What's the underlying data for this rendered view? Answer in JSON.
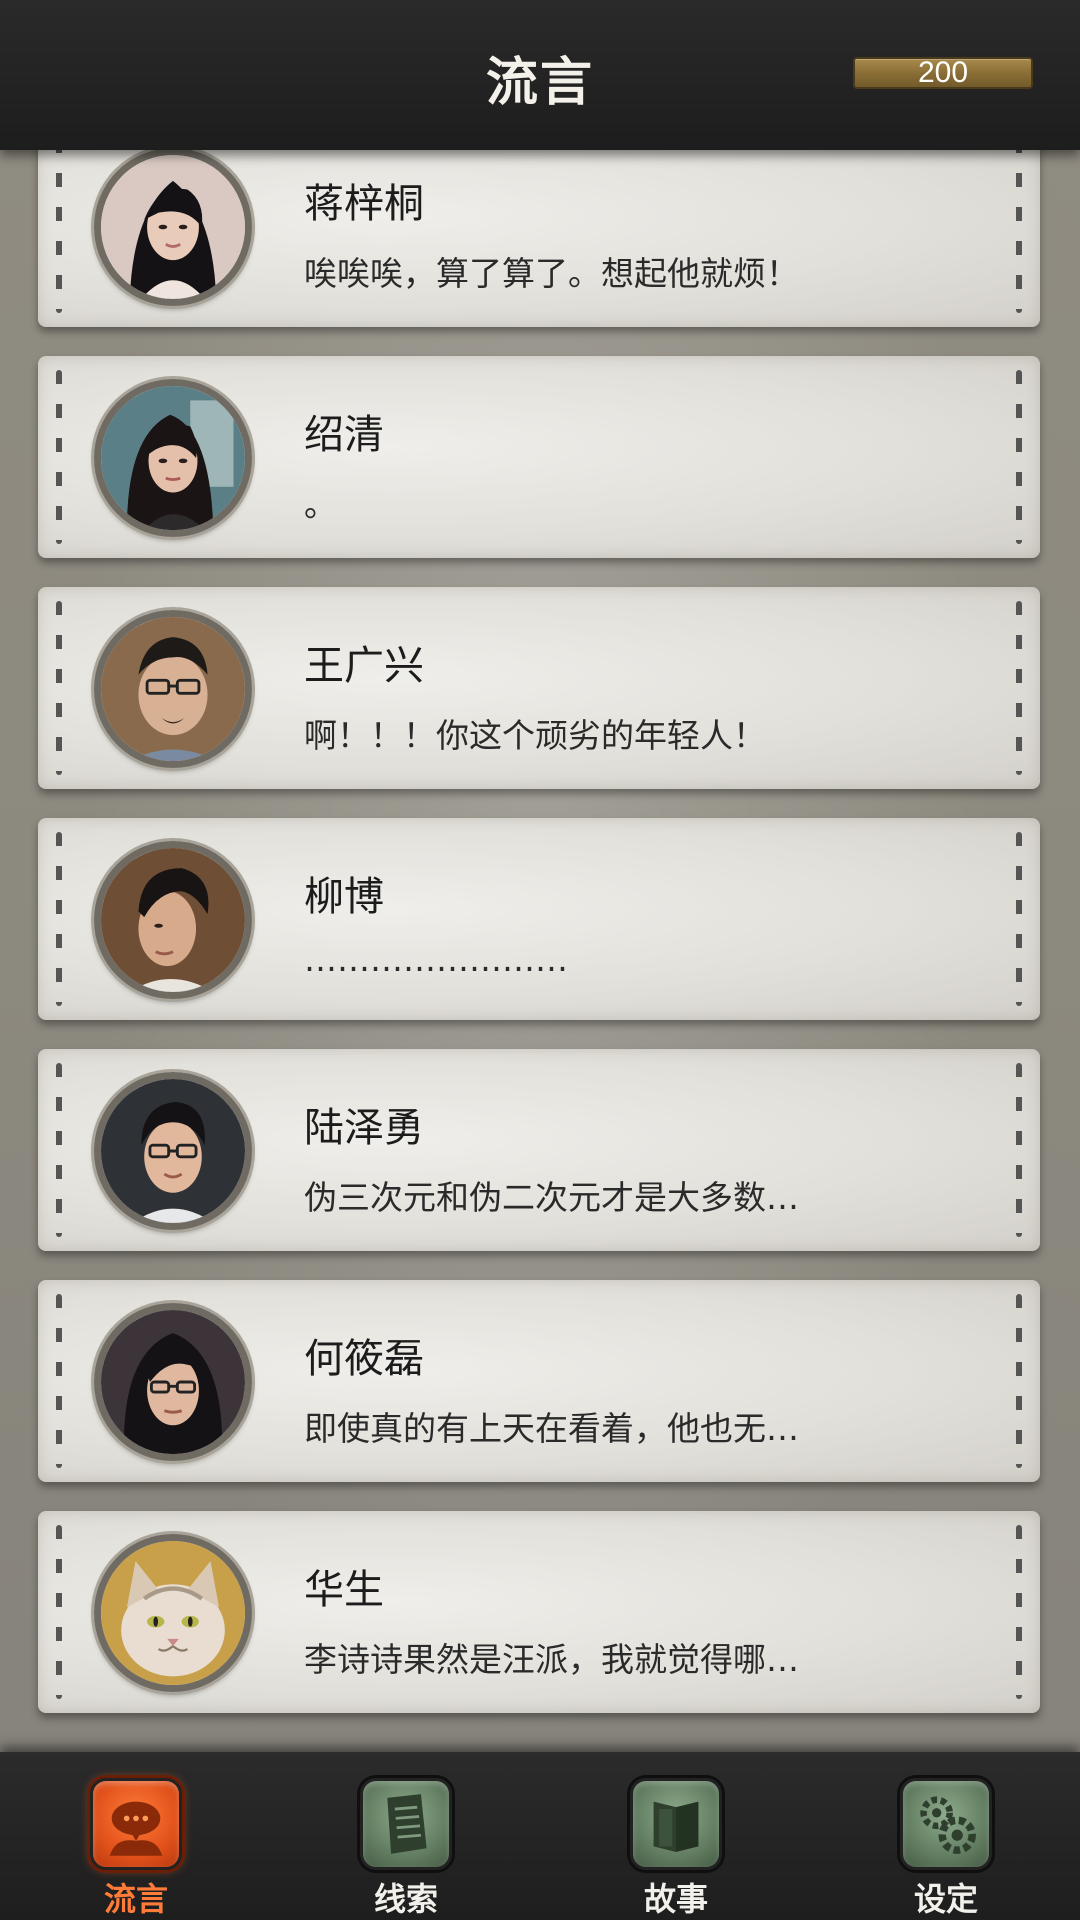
{
  "header": {
    "title": "流言",
    "coins": "200"
  },
  "messages": [
    {
      "name": "蒋梓桐",
      "text": "唉唉唉，算了算了。想起他就烦！",
      "avatar": "woman-portrait-1"
    },
    {
      "name": "绍清",
      "text": "。",
      "avatar": "woman-portrait-2"
    },
    {
      "name": "王广兴",
      "text": "啊！！！你这个顽劣的年轻人！",
      "avatar": "man-glasses-portrait"
    },
    {
      "name": "柳博",
      "text": "……………………",
      "avatar": "man-profile-portrait"
    },
    {
      "name": "陆泽勇",
      "text": "伪三次元和伪二次元才是大多数…",
      "avatar": "young-man-glasses-portrait"
    },
    {
      "name": "何筱磊",
      "text": "即使真的有上天在看着，他也无…",
      "avatar": "long-hair-man-portrait"
    },
    {
      "name": "华生",
      "text": "李诗诗果然是汪派，我就觉得哪…",
      "avatar": "cat-portrait"
    }
  ],
  "nav": [
    {
      "label": "流言",
      "icon": "chat-bubble-icon",
      "active": true
    },
    {
      "label": "线索",
      "icon": "document-icon",
      "active": false
    },
    {
      "label": "故事",
      "icon": "book-icon",
      "active": false
    },
    {
      "label": "设定",
      "icon": "gear-icon",
      "active": false
    }
  ],
  "colors": {
    "accent": "#ff7b3a",
    "nav_inactive": "#5f7a5e",
    "card": "#e2e0da",
    "header_bg": "#1d1d1d"
  }
}
